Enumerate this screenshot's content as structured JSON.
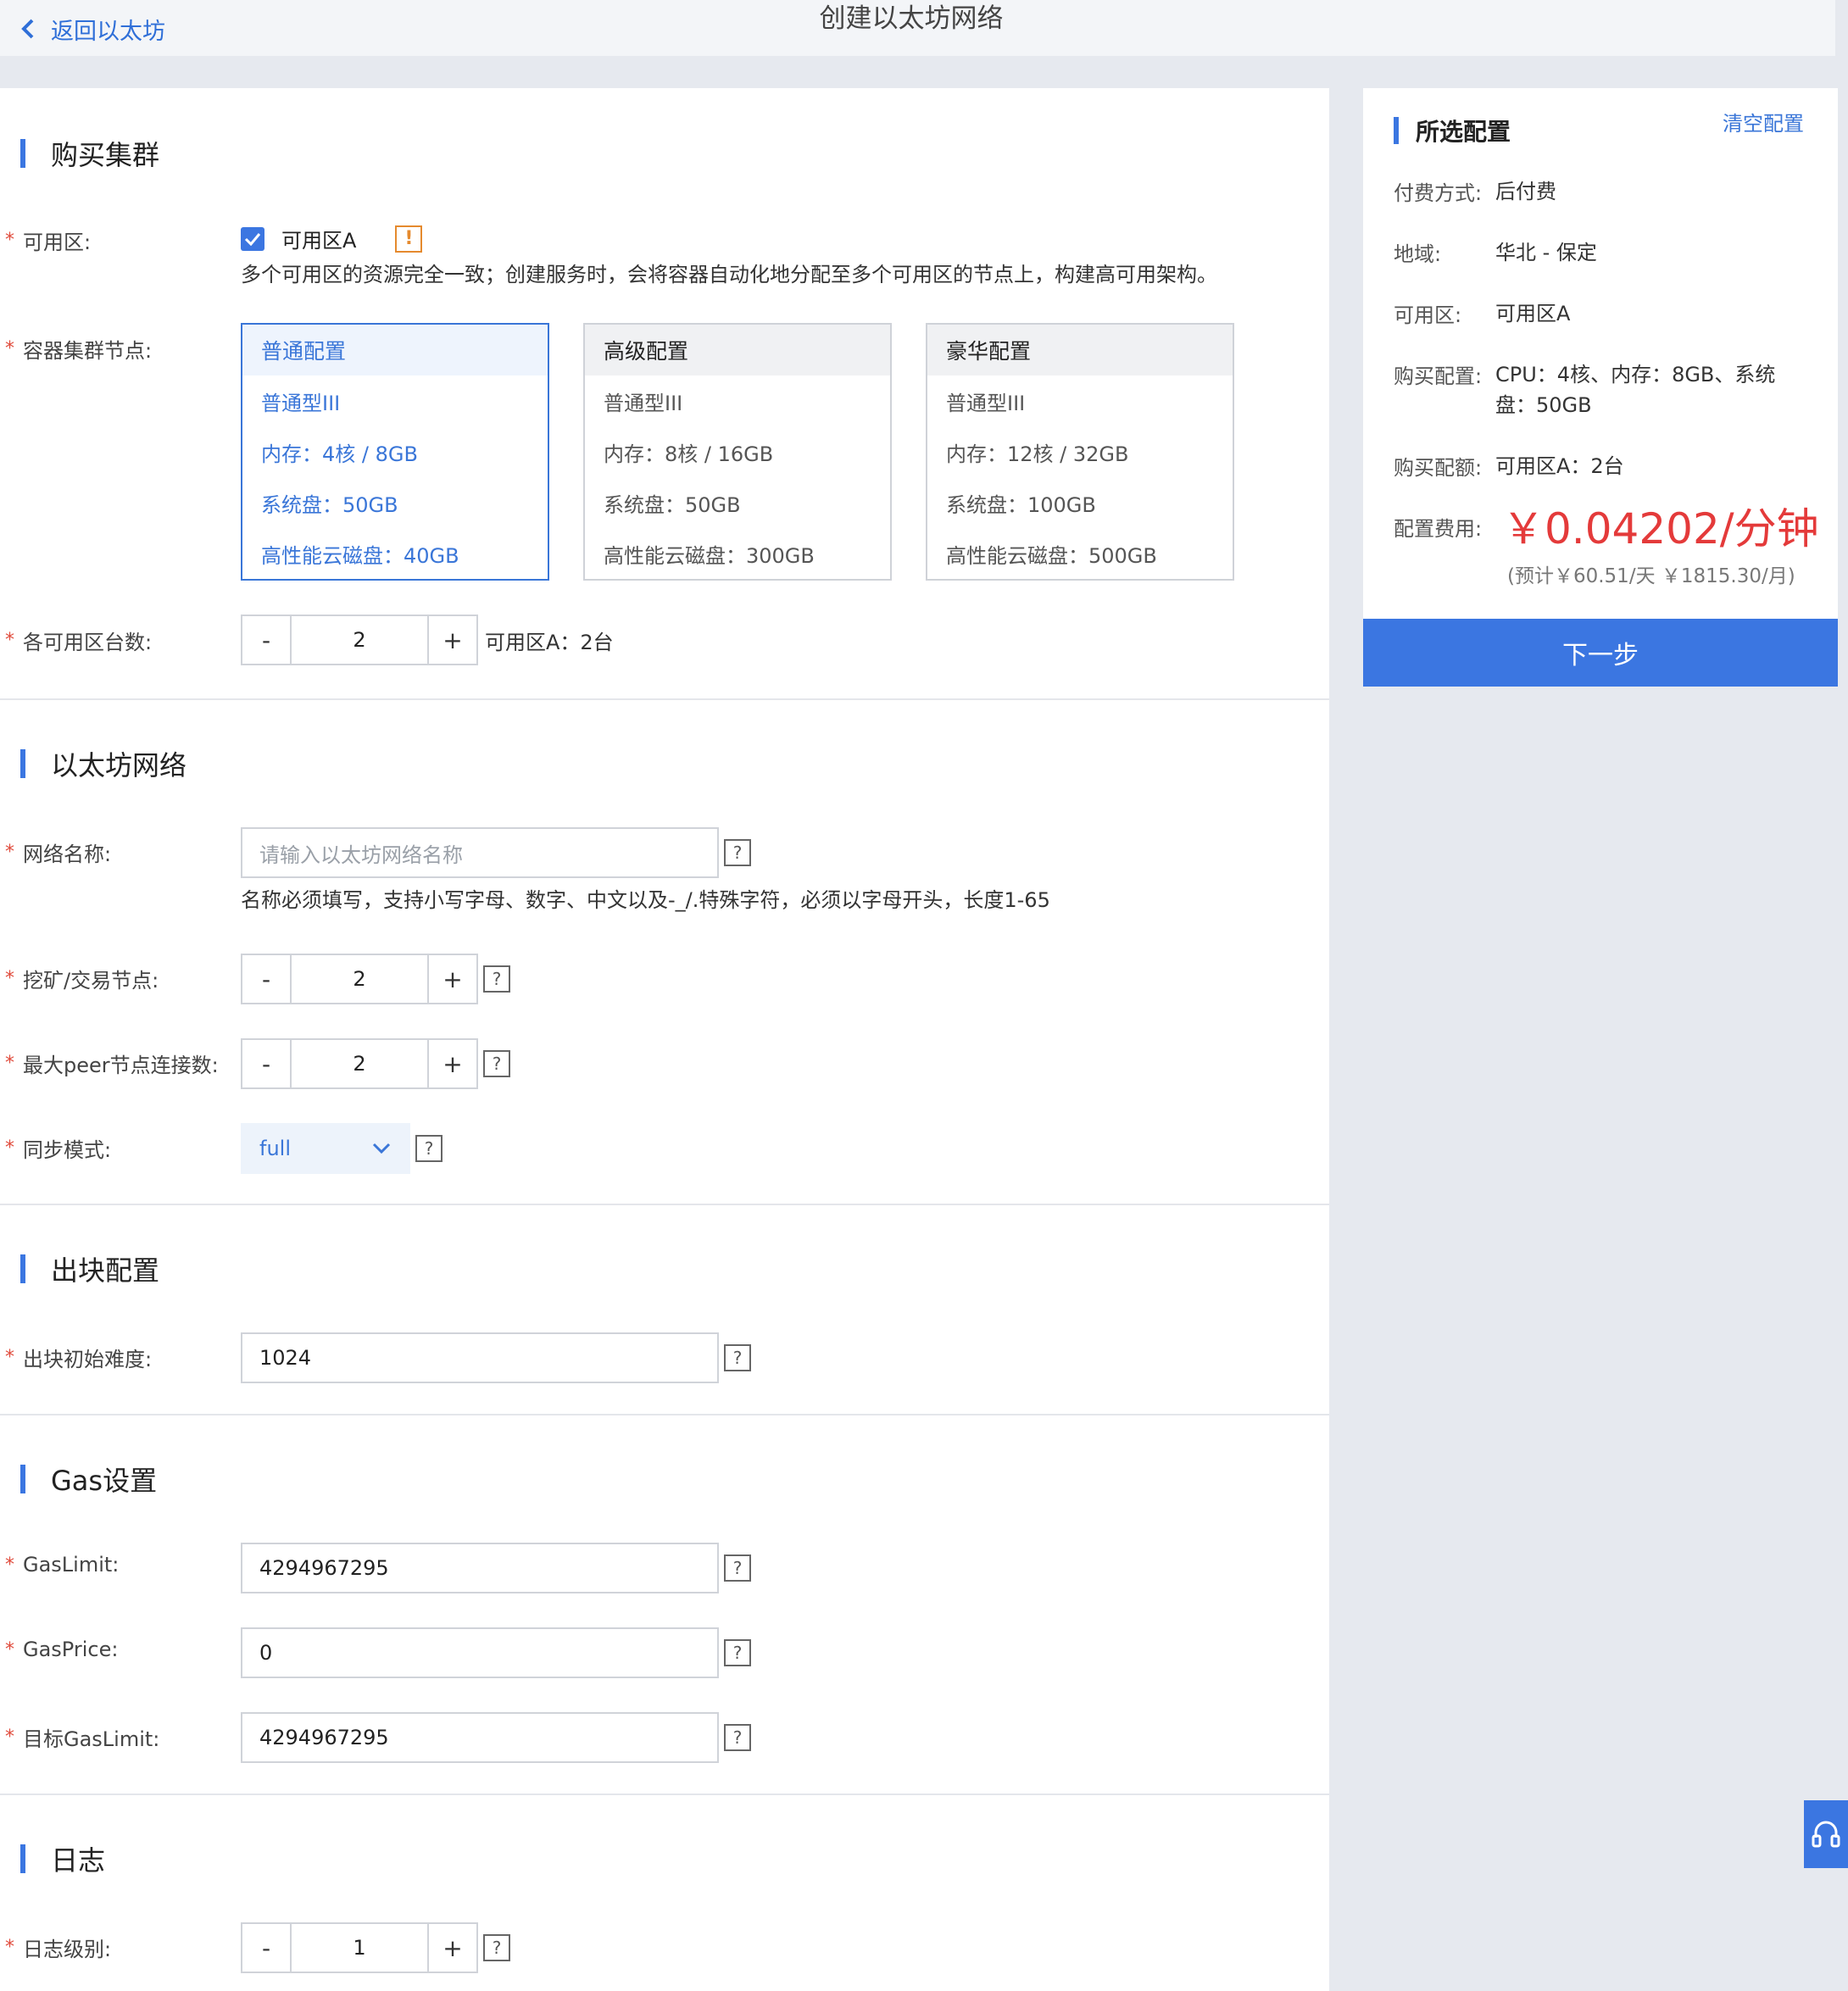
{
  "header": {
    "back_label": "返回以太坊",
    "title": "创建以太坊网络"
  },
  "cluster": {
    "title": "购买集群",
    "zone_label": "可用区:",
    "zone_option": "可用区A",
    "zone_checked": true,
    "zone_hint": "多个可用区的资源完全一致；创建服务时，会将容器自动化地分配至多个可用区的节点上，构建高可用架构。",
    "nodes_label": "容器集群节点:",
    "cards": [
      {
        "name": "普通配置",
        "type": "普通型III",
        "memory": "内存：4核 / 8GB",
        "disk": "系统盘：50GB",
        "cloud_disk": "高性能云磁盘：40GB",
        "active": true
      },
      {
        "name": "高级配置",
        "type": "普通型III",
        "memory": "内存：8核 / 16GB",
        "disk": "系统盘：50GB",
        "cloud_disk": "高性能云磁盘：300GB",
        "active": false
      },
      {
        "name": "豪华配置",
        "type": "普通型III",
        "memory": "内存：12核 / 32GB",
        "disk": "系统盘：100GB",
        "cloud_disk": "高性能云磁盘：500GB",
        "active": false
      }
    ],
    "count_label": "各可用区台数:",
    "count_value": "2",
    "count_hint": "可用区A：2台"
  },
  "network": {
    "title": "以太坊网络",
    "name_label": "网络名称:",
    "name_placeholder": "请输入以太坊网络名称",
    "name_hint": "名称必须填写，支持小写字母、数字、中文以及-_/.特殊字符，必须以字母开头，长度1-65",
    "miner_label": "挖矿/交易节点:",
    "miner_value": "2",
    "peer_label": "最大peer节点连接数:",
    "peer_value": "2",
    "sync_label": "同步模式:",
    "sync_value": "full"
  },
  "block": {
    "title": "出块配置",
    "difficulty_label": "出块初始难度:",
    "difficulty_value": "1024"
  },
  "gas": {
    "title": "Gas设置",
    "limit_label": "GasLimit:",
    "limit_value": "4294967295",
    "price_label": "GasPrice:",
    "price_value": "0",
    "target_label": "目标GasLimit:",
    "target_value": "4294967295"
  },
  "log": {
    "title": "日志",
    "level_label": "日志级别:",
    "level_value": "1"
  },
  "summary": {
    "title": "所选配置",
    "clear_label": "清空配置",
    "pay_label": "付费方式:",
    "pay_value": "后付费",
    "region_label": "地域:",
    "region_value": "华北 - 保定",
    "zone_label": "可用区:",
    "zone_value": "可用区A",
    "spec_label": "购买配置:",
    "spec_value": "CPU：4核、内存：8GB、系统盘：50GB",
    "quota_label": "购买配额:",
    "quota_value": "可用区A：2台",
    "cost_label": "配置费用:",
    "cost_value": "￥0.04202/分钟",
    "cost_sub": "(预计￥60.51/天 ￥1815.30/月)",
    "next_label": "下一步"
  },
  "symbols": {
    "minus": "-",
    "plus": "+",
    "help": "?",
    "warn": "!"
  },
  "colors": {
    "accent": "#3b76e1",
    "price": "#e43a3a",
    "required": "#e04b3c"
  }
}
